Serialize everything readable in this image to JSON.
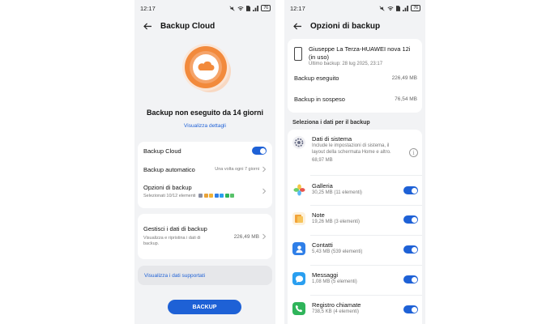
{
  "left": {
    "status": {
      "time": "12:17",
      "battery": "76"
    },
    "title": "Backup Cloud",
    "hero_status": "Backup non eseguito da 14 giorni",
    "details_link": "Visualizza dettagli",
    "backup_cloud_label": "Backup Cloud",
    "backup_cloud_on": true,
    "auto_backup_label": "Backup automatico",
    "auto_backup_value": "Una volta ogni 7 giorni",
    "options_label": "Opzioni di backup",
    "options_sub": "Selezionati 10/12 elementi",
    "manage_title": "Gestisci i dati di backup",
    "manage_sub": "Visualizza e ripristina i dati di backup.",
    "manage_size": "226,49 MB",
    "supported_link": "Visualizza i dati supportati",
    "backup_button": "BACKUP",
    "colors": {
      "accent": "#1e61d6",
      "cloud_orange": "#f28a3c"
    }
  },
  "right": {
    "status": {
      "time": "12:17",
      "battery": "76"
    },
    "title": "Opzioni di backup",
    "device_name": "Giuseppe La Terza-HUAWEI nova 12i (in uso)",
    "last_backup": "Ultimo backup: 28 lug 2025, 23:17",
    "done_label": "Backup eseguito",
    "done_value": "226,49 MB",
    "pending_label": "Backup in sospeso",
    "pending_value": "76,54 MB",
    "section_title": "Seleziona i dati per il backup",
    "items": [
      {
        "icon": "gear-icon",
        "title": "Dati di sistema",
        "desc": "Include le impostazioni di sistema, il layout della schermata Home e altro.",
        "size": "68,97 MB"
      },
      {
        "icon": "gallery-icon",
        "title": "Galleria",
        "sub": "30,25 MB (11 elementi)",
        "on": true
      },
      {
        "icon": "notes-icon",
        "title": "Note",
        "sub": "19,26 MB (3 elementi)",
        "on": true
      },
      {
        "icon": "contacts-icon",
        "title": "Contatti",
        "sub": "5,43 MB (539 elementi)",
        "on": true
      },
      {
        "icon": "messages-icon",
        "title": "Messaggi",
        "sub": "1,08 MB (5 elementi)",
        "on": true
      },
      {
        "icon": "phone-icon",
        "title": "Registro chiamate",
        "sub": "738,5 KB (4 elementi)",
        "on": true
      }
    ]
  }
}
